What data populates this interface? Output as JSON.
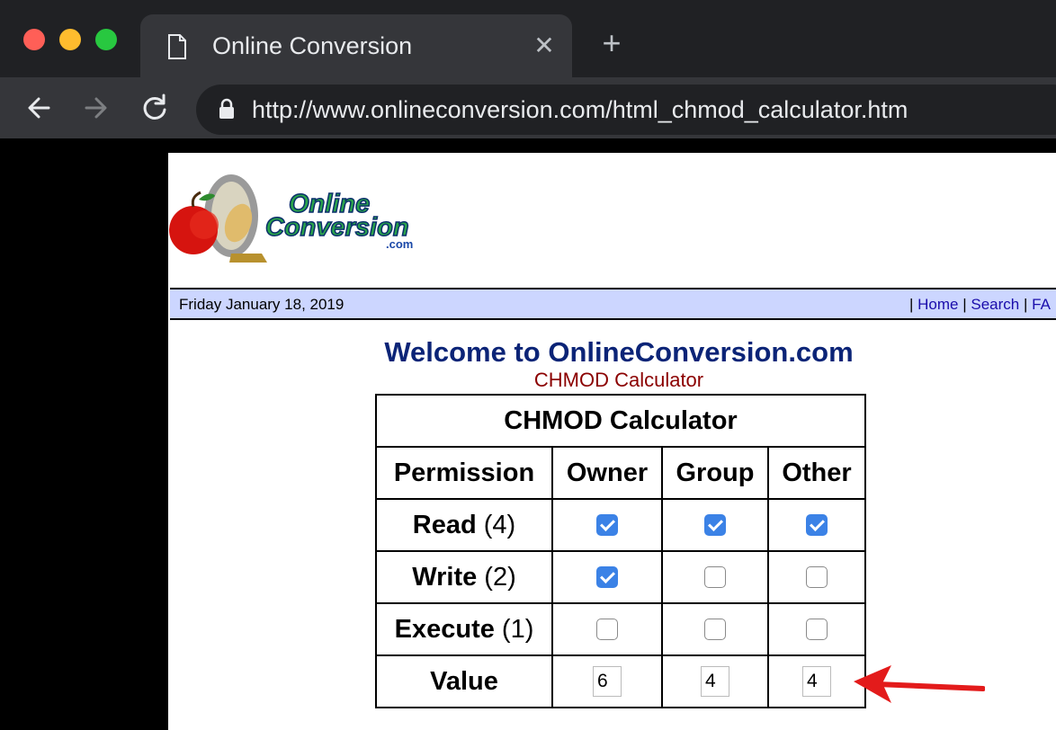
{
  "browser": {
    "tab_title": "Online Conversion",
    "tab_close": "✕",
    "new_tab": "+",
    "url": "http://www.onlineconversion.com/html_chmod_calculator.htm"
  },
  "logo": {
    "line1": "Online",
    "line2": "Conversion",
    "line3": ".com"
  },
  "datebar": {
    "date": "Friday January 18, 2019",
    "sep1": "| ",
    "home": "Home",
    "sep2": " | ",
    "search": "Search",
    "sep3": " | ",
    "faq": "FA"
  },
  "heading": {
    "welcome": "Welcome to OnlineConversion.com",
    "subtitle": "CHMOD Calculator"
  },
  "calculator": {
    "caption": "CHMOD Calculator",
    "headers": [
      "Permission",
      "Owner",
      "Group",
      "Other"
    ],
    "rows": [
      {
        "name": "Read",
        "weight": " (4)",
        "owner": true,
        "group": true,
        "other": true
      },
      {
        "name": "Write",
        "weight": " (2)",
        "owner": true,
        "group": false,
        "other": false
      },
      {
        "name": "Execute",
        "weight": " (1)",
        "owner": false,
        "group": false,
        "other": false
      }
    ],
    "value_label": "Value",
    "values": {
      "owner": "6",
      "group": "4",
      "other": "4"
    }
  },
  "colors": {
    "arrow": "#e31b1b",
    "checked": "#3b82e6"
  }
}
